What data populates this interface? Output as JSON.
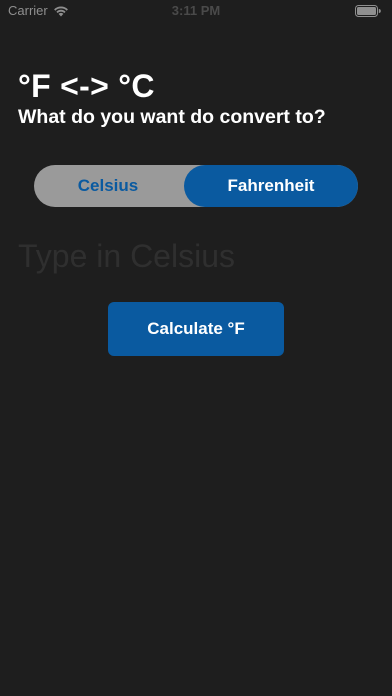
{
  "status_bar": {
    "carrier": "Carrier",
    "time": "3:11 PM",
    "icons": [
      "wifi-icon",
      "battery-icon"
    ]
  },
  "header": {
    "title": "°F <-> °C",
    "subtitle": "What do you want do convert to?"
  },
  "converter": {
    "segments": [
      {
        "label": "Celsius",
        "selected": false
      },
      {
        "label": "Fahrenheit",
        "selected": true
      }
    ],
    "input": {
      "value": "",
      "placeholder": "Type in Celsius"
    },
    "calculate_label": "Calculate °F"
  },
  "colors": {
    "background": "#1e1e1e",
    "accent": "#0a5aa0",
    "segment_track": "#9a9a9a",
    "placeholder": "#2f2f2f"
  }
}
